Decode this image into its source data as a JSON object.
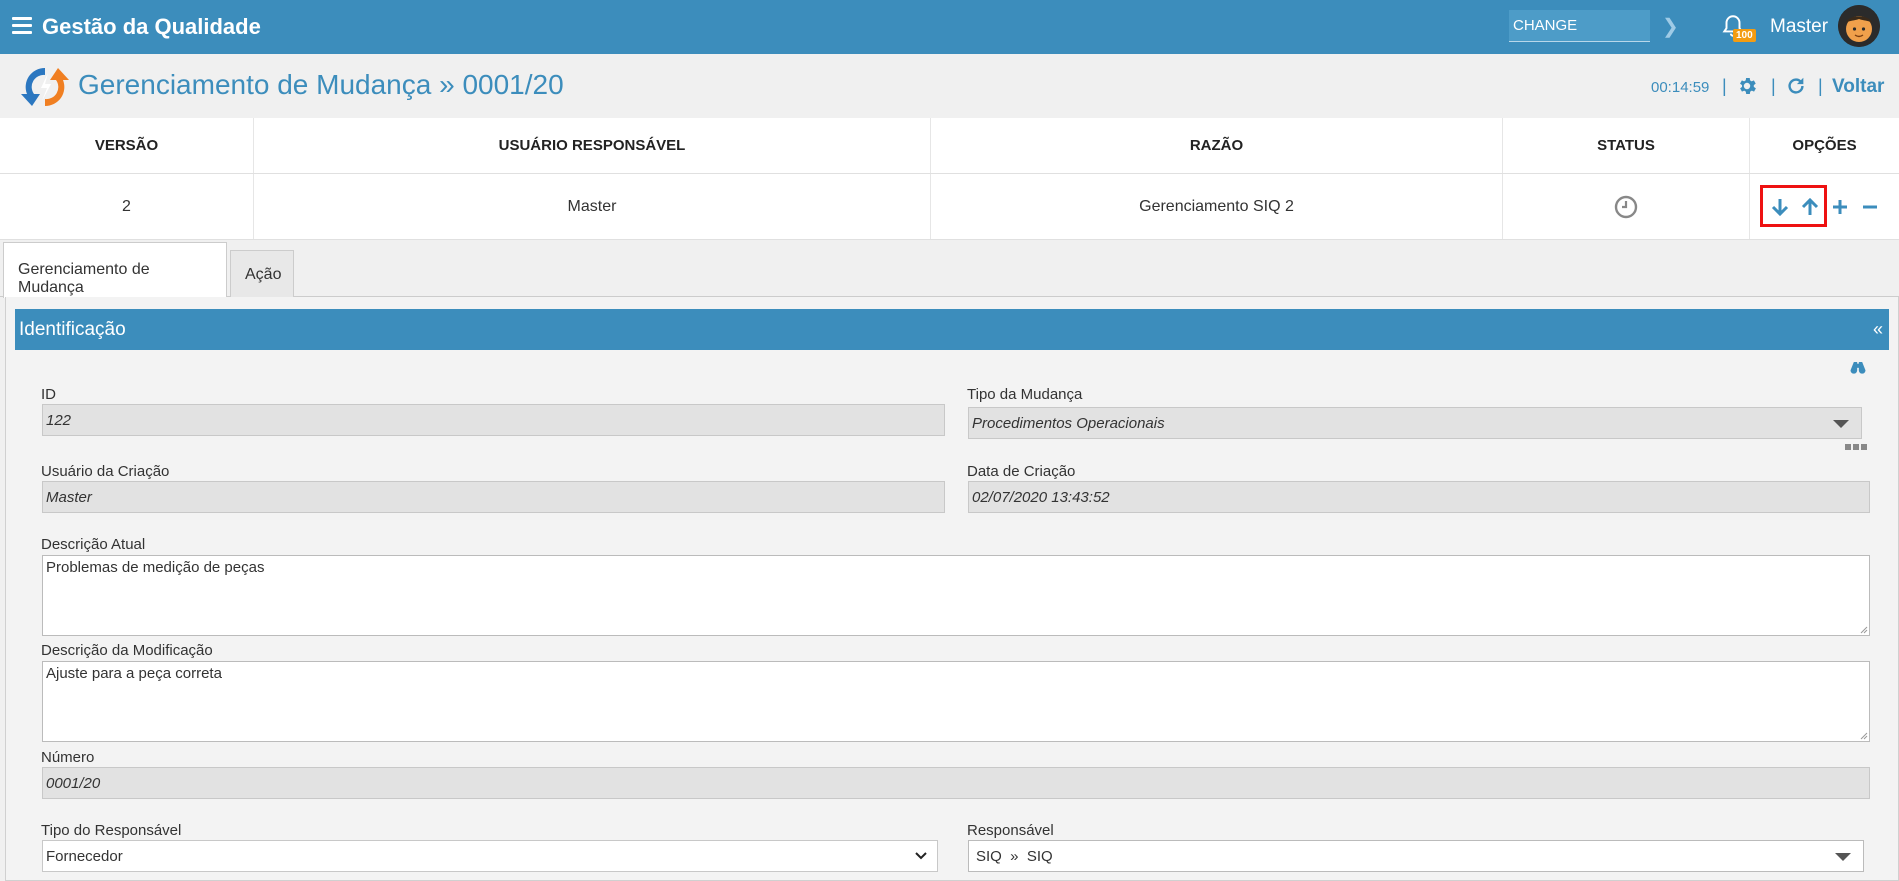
{
  "app": {
    "title": "Gestão da Qualidade"
  },
  "topbar": {
    "search_value": "CHANGE",
    "notification_count": "100",
    "user_name": "Master"
  },
  "header": {
    "title": "Gerenciamento de Mudança » 0001/20",
    "timer": "00:14:59",
    "separator": "|",
    "back_label": "Voltar"
  },
  "version_table": {
    "columns": [
      "VERSÃO",
      "USUÁRIO RESPONSÁVEL",
      "RAZÃO",
      "STATUS",
      "OPÇÕES"
    ],
    "rows": [
      {
        "versao": "2",
        "usuario": "Master",
        "razao": "Gerenciamento SIQ 2",
        "status_icon": "clock-icon"
      }
    ]
  },
  "tabs": [
    {
      "label": "Gerenciamento de Mudança",
      "active": true
    },
    {
      "label": "Ação",
      "active": false
    }
  ],
  "section": {
    "title": "Identificação",
    "collapse_symbol": "«"
  },
  "form": {
    "id": {
      "label": "ID",
      "value": "122"
    },
    "tipo_mudanca": {
      "label": "Tipo da Mudança",
      "value": "Procedimentos Operacionais"
    },
    "usuario_criacao": {
      "label": "Usuário da Criação",
      "value": "Master"
    },
    "data_criacao": {
      "label": "Data de Criação",
      "value": "02/07/2020 13:43:52"
    },
    "descricao_atual": {
      "label": "Descrição Atual",
      "value": "Problemas de medição de peças"
    },
    "descricao_modificacao": {
      "label": "Descrição da Modificação",
      "value": "Ajuste para a peça correta"
    },
    "numero": {
      "label": "Número",
      "value": "0001/20"
    },
    "tipo_responsavel": {
      "label": "Tipo do Responsável",
      "value": "Fornecedor"
    },
    "responsavel": {
      "label": "Responsável",
      "value": "SIQ  »  SIQ"
    }
  },
  "colors": {
    "primary": "#3c8dbc",
    "badge": "#f39c12",
    "highlight": "#e11111",
    "logo_orange": "#f07f22",
    "logo_blue": "#2b77c0"
  }
}
